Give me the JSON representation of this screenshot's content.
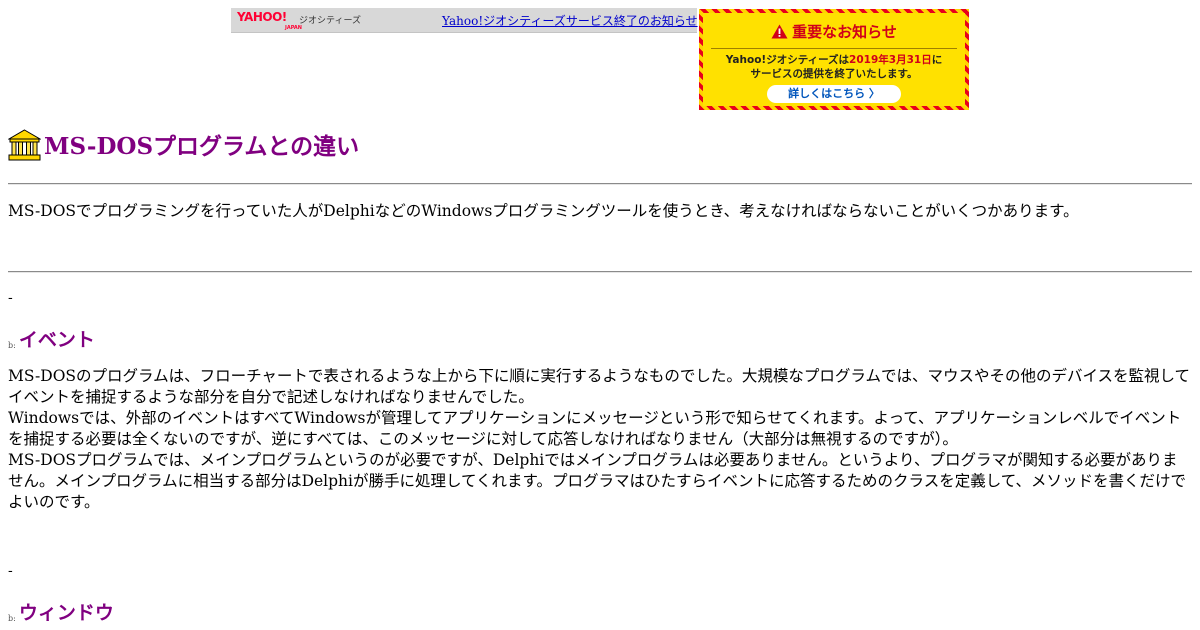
{
  "banner": {
    "logo": "YAHOO!",
    "logo_sub": "JAPAN",
    "service": "ジオシティーズ",
    "link": "Yahoo!ジオシティーズサービス終了のお知らせ"
  },
  "notice": {
    "title": "重要なお知らせ",
    "line1_pre": "Yahoo!ジオシティーズは",
    "line1_date": "2019年3月31日",
    "line1_post": "に",
    "line2": "サービスの提供を終了いたします。",
    "button": "詳しくはこちら 〉"
  },
  "page": {
    "title": "MS-DOSプログラムとの違い",
    "intro": "MS-DOSでプログラミングを行っていた人がDelphiなどのWindowsプログラミングツールを使うとき、考えなければならないことがいくつかあります。",
    "dash": "-",
    "img_alt": "b:"
  },
  "sections": [
    {
      "heading": "イベント",
      "paragraphs": [
        "MS-DOSのプログラムは、フローチャートで表されるような上から下に順に実行するようなものでした。大規模なプログラムでは、マウスやその他のデバイスを監視してイベントを捕捉するような部分を自分で記述しなければなりませんでした。",
        "Windowsでは、外部のイベントはすべてWindowsが管理してアプリケーションにメッセージという形で知らせてくれます。よって、アプリケーションレベルでイベントを捕捉する必要は全くないのですが、逆にすべては、このメッセージに対して応答しなければなりません（大部分は無視するのですが）。",
        "MS-DOSプログラムでは、メインプログラムというのが必要ですが、Delphiではメインプログラムは必要ありません。というより、プログラマが関知する必要がありません。メインプログラムに相当する部分はDelphiが勝手に処理してくれます。プログラマはひたすらイベントに応答するためのクラスを定義して、メソッドを書くだけでよいのです。"
      ]
    },
    {
      "heading": "ウィンドウ"
    }
  ],
  "colors": {
    "heading": "#800080",
    "link": "#0000cc",
    "notice_red": "#d0001a",
    "notice_yellow": "#ffe100"
  }
}
